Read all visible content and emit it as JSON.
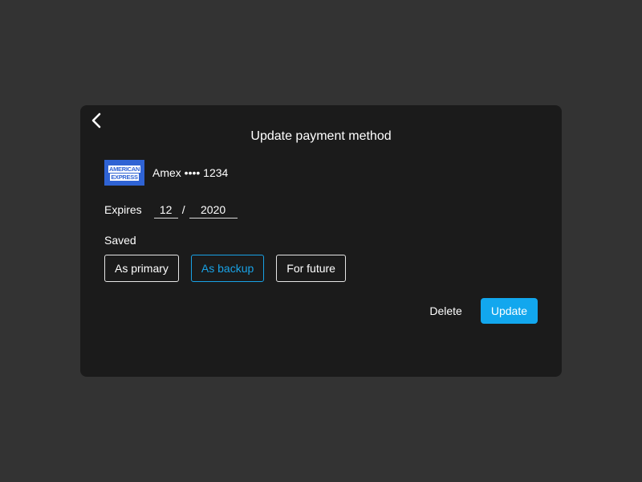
{
  "dialog": {
    "title": "Update payment method",
    "back_icon": "chevron-left-icon"
  },
  "card": {
    "logo_line1": "AMERICAN",
    "logo_line2": "EXPRESS",
    "logo_color": "#2f63d4",
    "label": "Amex •••• 1234"
  },
  "expires": {
    "label": "Expires",
    "month": "12",
    "separator": "/",
    "year": "2020"
  },
  "saved": {
    "label": "Saved",
    "options": [
      {
        "label": "As primary",
        "selected": false
      },
      {
        "label": "As backup",
        "selected": true
      },
      {
        "label": "For future",
        "selected": false
      }
    ]
  },
  "actions": {
    "delete_label": "Delete",
    "update_label": "Update"
  },
  "colors": {
    "background": "#333333",
    "dialog": "#1b1b1b",
    "accent": "#12a7ee",
    "selected_border": "#19a2e6"
  }
}
